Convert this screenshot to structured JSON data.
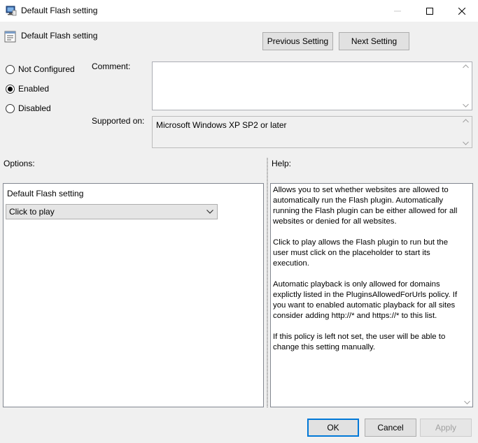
{
  "window": {
    "title": "Default Flash setting"
  },
  "header": {
    "policy_name": "Default Flash setting",
    "prev_label": "Previous Setting",
    "next_label": "Next Setting"
  },
  "state": {
    "options": [
      {
        "label": "Not Configured",
        "checked": false
      },
      {
        "label": "Enabled",
        "checked": true
      },
      {
        "label": "Disabled",
        "checked": false
      }
    ]
  },
  "comment": {
    "label": "Comment:",
    "value": ""
  },
  "supported": {
    "label": "Supported on:",
    "value": "Microsoft Windows XP SP2 or later"
  },
  "options_section": {
    "label": "Options:",
    "setting_label": "Default Flash setting",
    "selected": "Click to play"
  },
  "help_section": {
    "label": "Help:",
    "paragraphs": [
      "Allows you to set whether websites are allowed to automatically run the Flash plugin. Automatically running the Flash plugin can be either allowed for all websites or denied for all websites.",
      "Click to play allows the Flash plugin to run but the user must click on the placeholder to start its execution.",
      "Automatic playback is only allowed for domains explictly listed in the PluginsAllowedForUrls policy. If you want to enabled automatic playback for all sites consider adding http://* and https://* to this list.",
      "If this policy is left not set, the user will be able to change this setting manually."
    ]
  },
  "footer": {
    "ok_label": "OK",
    "cancel_label": "Cancel",
    "apply_label": "Apply"
  },
  "colors": {
    "accent": "#0078d7",
    "window_bg": "#f0f0f0"
  }
}
